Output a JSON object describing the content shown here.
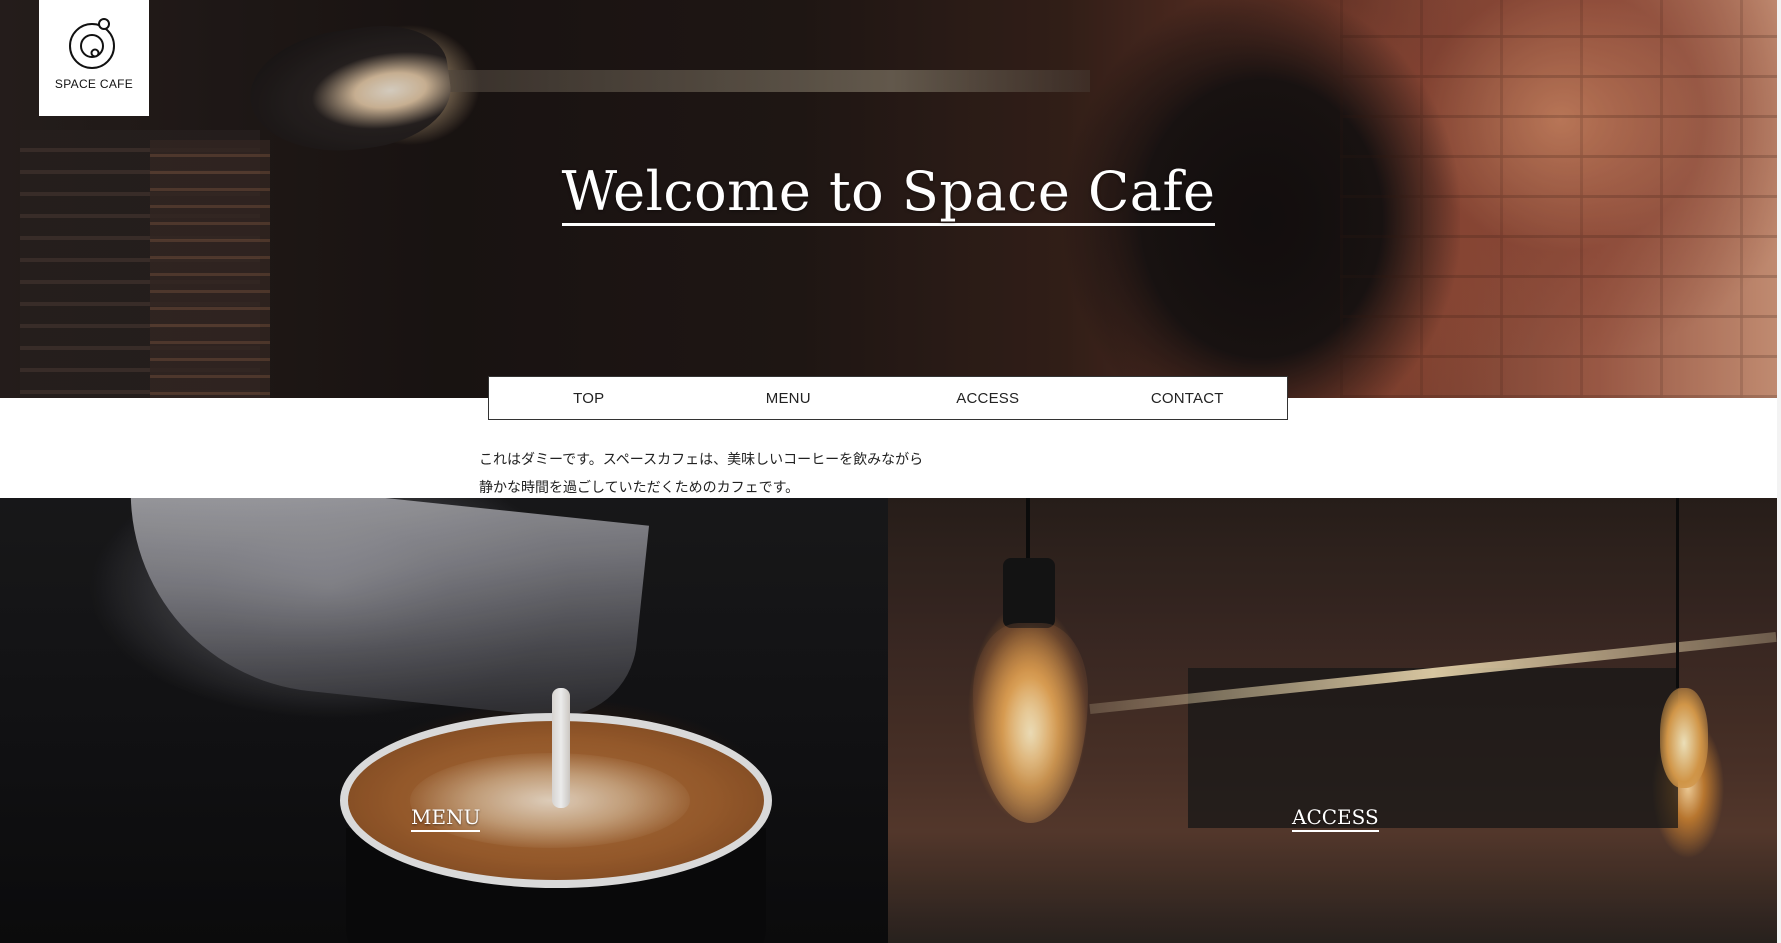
{
  "header": {
    "logo": {
      "icon": "planet-orbit-icon",
      "text": "SPACE CAFE"
    },
    "title": "Welcome to Space Cafe"
  },
  "nav": {
    "items": [
      {
        "label": "TOP"
      },
      {
        "label": "MENU"
      },
      {
        "label": "ACCESS"
      },
      {
        "label": "CONTACT"
      }
    ]
  },
  "intro": {
    "line1": "これはダミーです。スペースカフェは、美味しいコーヒーを飲みながら",
    "line2": "静かな時間を過ごしていただくためのカフェです。"
  },
  "panels": [
    {
      "label": "MENU",
      "image": "latte-art-pour"
    },
    {
      "label": "ACCESS",
      "image": "cafe-interior-bulbs"
    }
  ],
  "colors": {
    "overlay_text": "#ffffff",
    "nav_border": "#333333",
    "body_text": "#222222"
  }
}
